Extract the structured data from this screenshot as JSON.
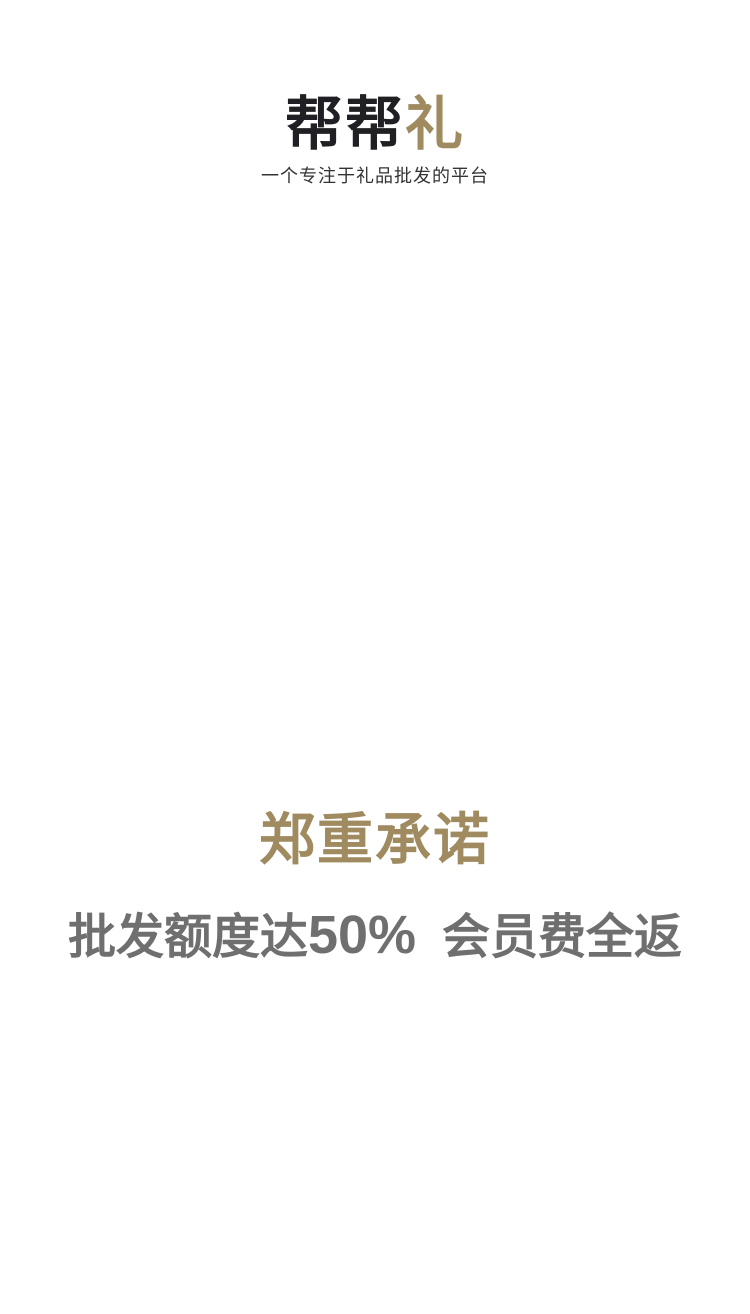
{
  "brand": {
    "name_main": "帮帮",
    "name_accent": "礼",
    "tagline": "一个专注于礼品批发的平台"
  },
  "promise": {
    "title": "郑重承诺",
    "line_prefix": "批发额度达",
    "line_value": "50%",
    "line_suffix": "会员费全返"
  },
  "colors": {
    "brand_dark": "#1f1f24",
    "gold": "#a08a5f",
    "gray_text": "#6f6f6f",
    "background": "#ffffff"
  }
}
